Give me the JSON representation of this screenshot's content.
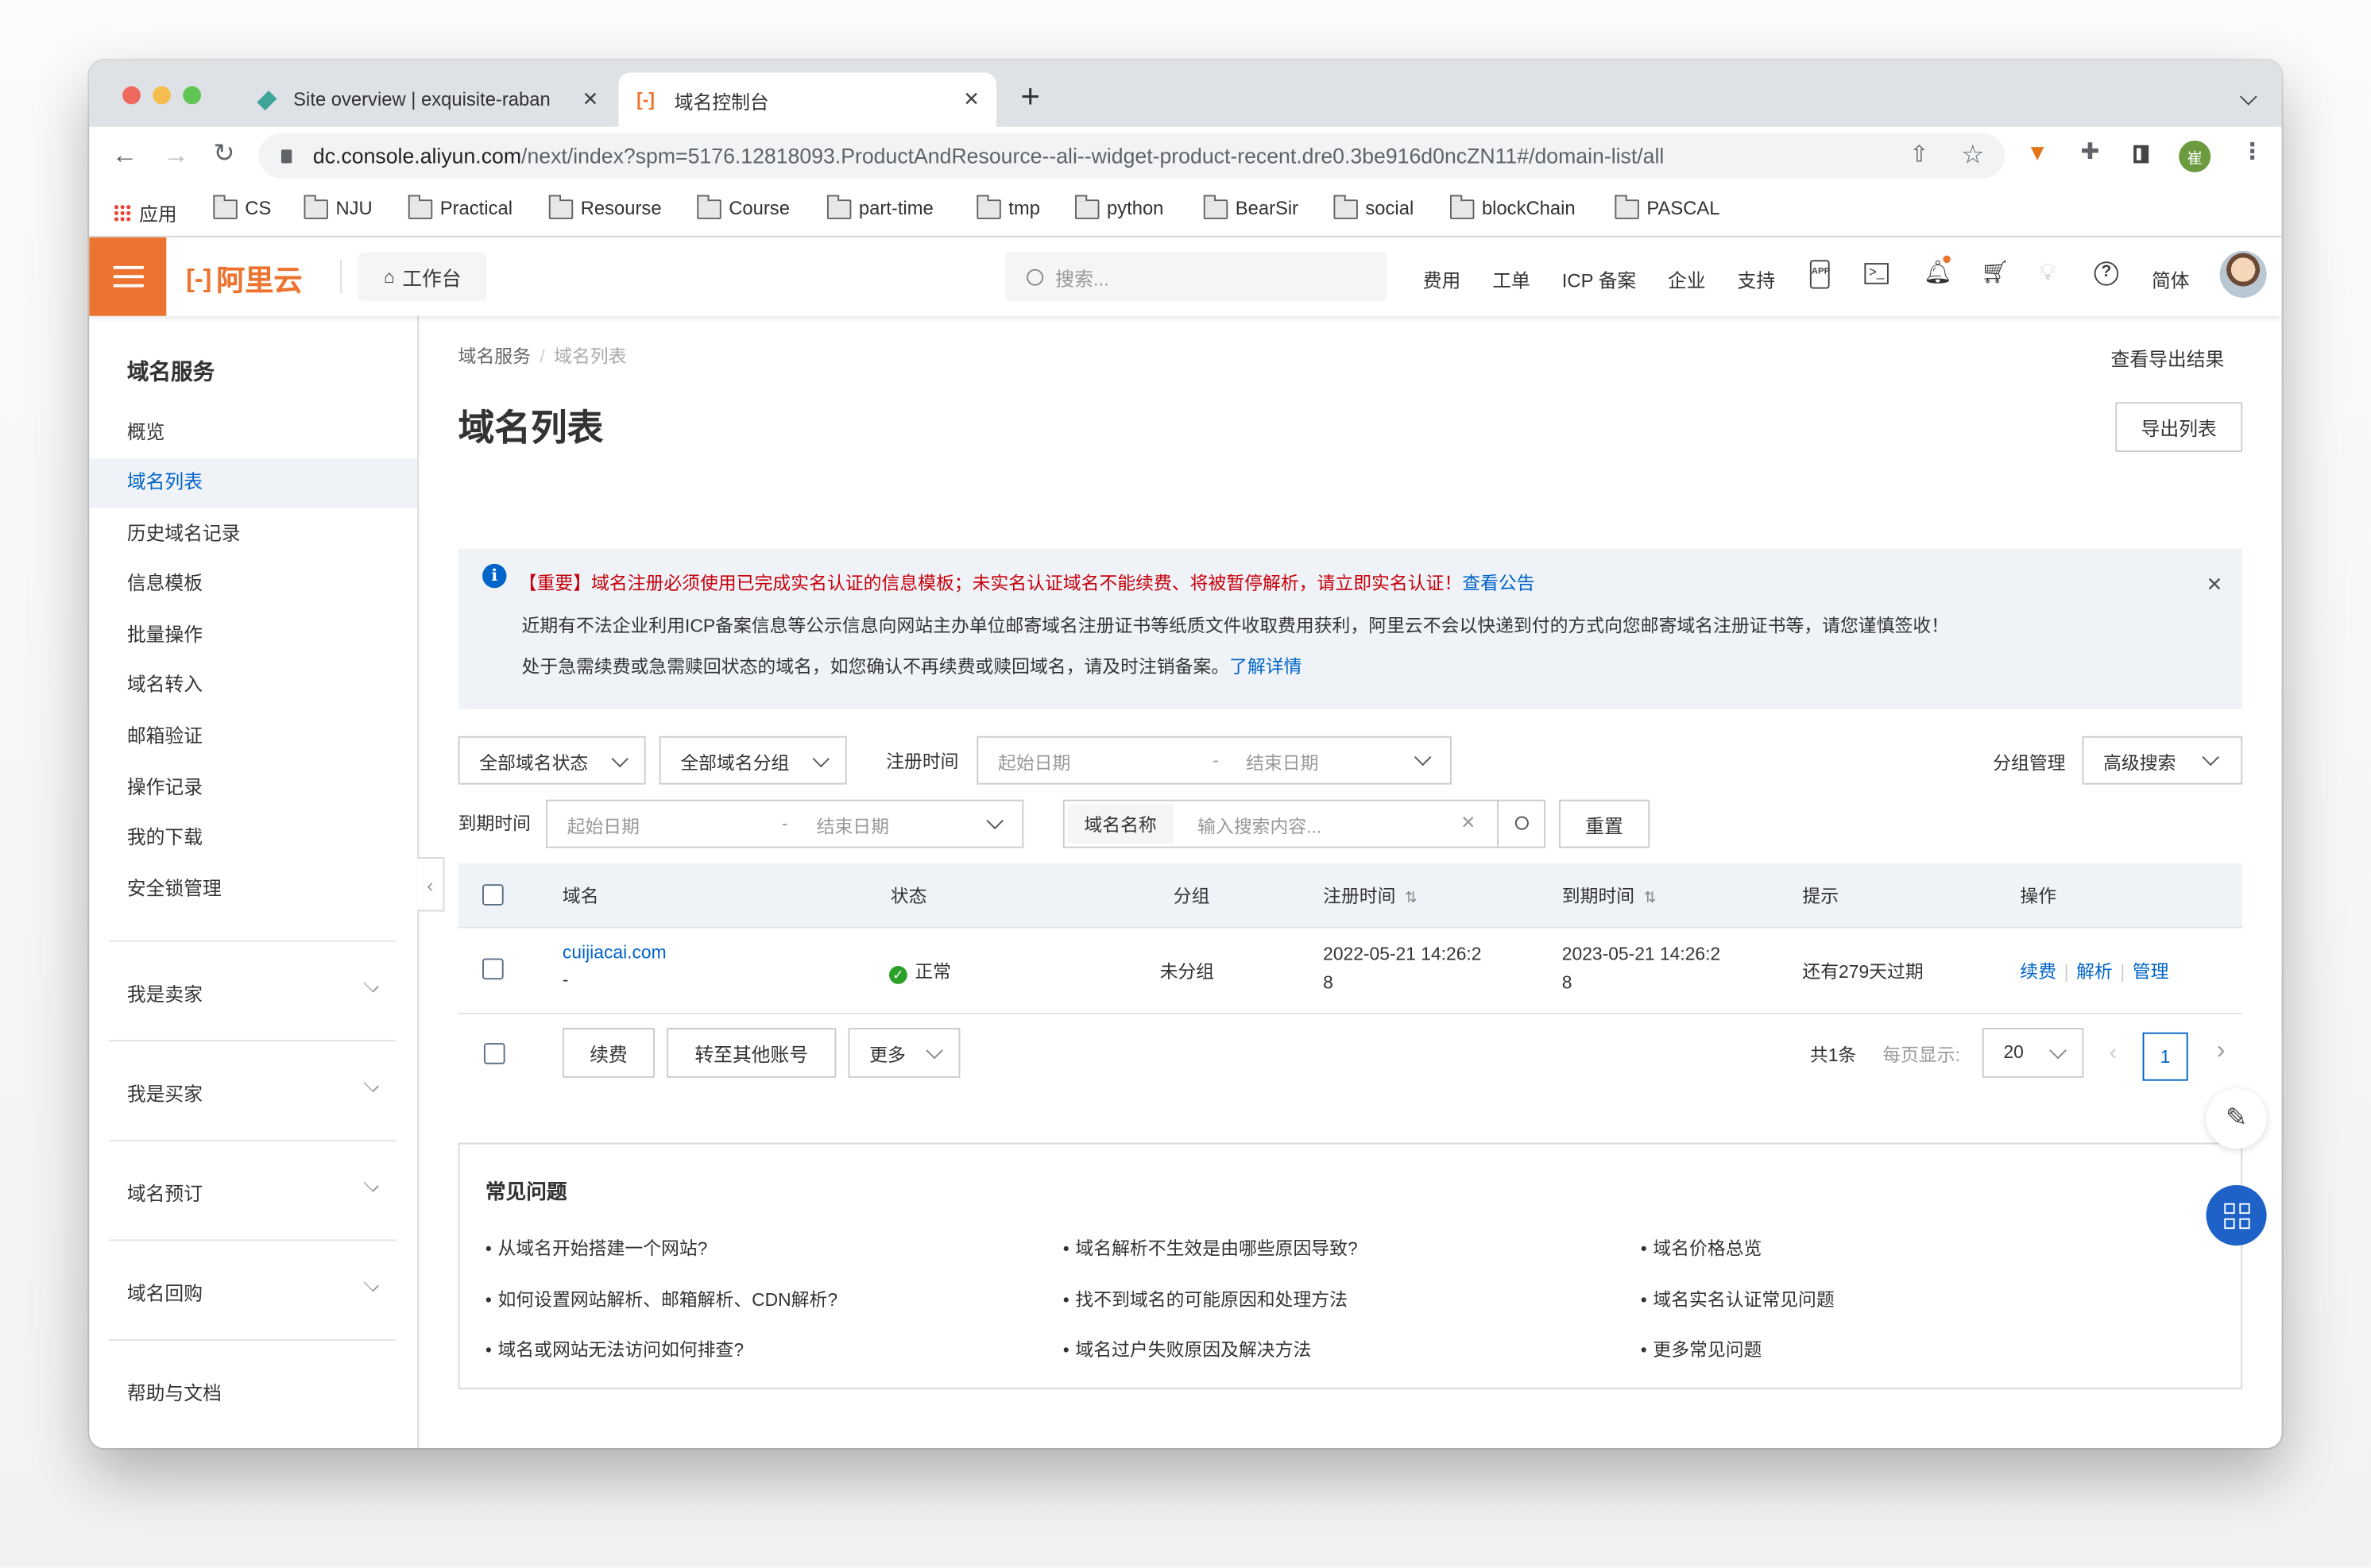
{
  "browser": {
    "tabs": [
      {
        "title": "Site overview | exquisite-raban",
        "icon": "netlify-diamond-icon",
        "active": false
      },
      {
        "title": "域名控制台",
        "icon": "aliyun-logo-icon",
        "active": true
      }
    ],
    "new_tab": "+",
    "url_host": "dc.console.aliyun.com",
    "url_rest": "/next/index?spm=5176.12818093.ProductAndResource--ali--widget-product-recent.dre0.3be916d0ncZN11#/domain-list/all",
    "profile_initial": "崔",
    "bookmarks": [
      "应用",
      "CS",
      "NJU",
      "Practical",
      "Resourse",
      "Course",
      "part-time",
      "tmp",
      "python",
      "BearSir",
      "social",
      "blockChain",
      "PASCAL"
    ]
  },
  "console": {
    "logo_text": "阿里云",
    "workbench": "工作台",
    "search_placeholder": "搜索...",
    "nav": [
      "费用",
      "工单",
      "ICP 备案",
      "企业",
      "支持"
    ],
    "lang": "简体"
  },
  "sidebar": {
    "title": "域名服务",
    "items": [
      {
        "label": "概览",
        "active": false
      },
      {
        "label": "域名列表",
        "active": true
      },
      {
        "label": "历史域名记录",
        "active": false
      },
      {
        "label": "信息模板",
        "active": false
      },
      {
        "label": "批量操作",
        "active": false
      },
      {
        "label": "域名转入",
        "active": false
      },
      {
        "label": "邮箱验证",
        "active": false
      },
      {
        "label": "操作记录",
        "active": false
      },
      {
        "label": "我的下载",
        "active": false
      },
      {
        "label": "安全锁管理",
        "active": false
      }
    ],
    "groups": [
      "我是卖家",
      "我是买家",
      "域名预订",
      "域名回购"
    ],
    "help": "帮助与文档"
  },
  "main": {
    "breadcrumb": [
      "域名服务",
      "域名列表"
    ],
    "export_result": "查看导出结果",
    "title": "域名列表",
    "export_button": "导出列表",
    "notice": {
      "line1": "【重要】域名注册必须使用已完成实名认证的信息模板；未实名认证域名不能续费、将被暂停解析，请立即实名认证！",
      "line1_link": "查看公告",
      "line2": "近期有不法企业利用ICP备案信息等公示信息向网站主办单位邮寄域名注册证书等纸质文件收取费用获利，阿里云不会以快递到付的方式向您邮寄域名注册证书等，请您谨慎签收！",
      "line3": "处于急需续费或急需赎回状态的域名，如您确认不再续费或赎回域名，请及时注销备案。",
      "line3_link": "了解详情"
    },
    "filters": {
      "status": "全部域名状态",
      "group": "全部域名分组",
      "reg_time_label": "注册时间",
      "start_placeholder": "起始日期",
      "end_placeholder": "结束日期",
      "group_manage": "分组管理",
      "advanced_search": "高级搜索",
      "exp_time_label": "到期时间",
      "name_label": "域名名称",
      "name_placeholder": "输入搜索内容...",
      "reset": "重置"
    },
    "table": {
      "columns": [
        "域名",
        "状态",
        "分组",
        "注册时间",
        "到期时间",
        "提示",
        "操作"
      ],
      "rows": [
        {
          "domain": "cuijiacai.com",
          "sub": "-",
          "status": "正常",
          "group": "未分组",
          "reg_time_1": "2022-05-21 14:26:2",
          "reg_time_2": "8",
          "exp_time_1": "2023-05-21 14:26:2",
          "exp_time_2": "8",
          "hint": "还有279天过期",
          "actions": [
            "续费",
            "解析",
            "管理"
          ]
        }
      ]
    },
    "batch": {
      "renew": "续费",
      "transfer": "转至其他账号",
      "more": "更多"
    },
    "pager": {
      "total": "共1条",
      "per_page_label": "每页显示:",
      "per_page": "20",
      "current": "1"
    },
    "faq": {
      "title": "常见问题",
      "items": [
        "从域名开始搭建一个网站?",
        "域名解析不生效是由哪些原因导致?",
        "域名价格总览",
        "如何设置网站解析、邮箱解析、CDN解析?",
        "找不到域名的可能原因和处理方法",
        "域名实名认证常见问题",
        "域名或网站无法访问如何排查?",
        "域名过户失败原因及解决方法",
        "更多常见问题"
      ]
    }
  },
  "colors": {
    "brand": "#ed7430",
    "link": "#0064c8",
    "warning": "#c7000b",
    "annotation_arrow": "#e53a26"
  }
}
